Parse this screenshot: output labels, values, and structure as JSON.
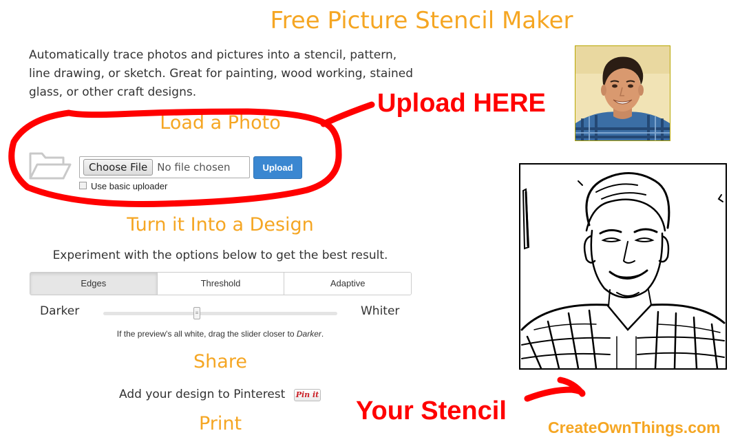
{
  "header": {
    "title": "Free Picture Stencil Maker"
  },
  "intro": {
    "text": "Automatically trace photos and pictures into a stencil, pattern, line drawing, or sketch. Great for painting, wood working, stained glass, or other craft designs."
  },
  "load": {
    "heading": "Load a Photo",
    "choose_file_label": "Choose File",
    "file_status": "No file chosen",
    "upload_label": "Upload",
    "basic_uploader_label": "Use basic uploader",
    "basic_uploader_checked": false
  },
  "design": {
    "heading": "Turn it Into a Design",
    "instructions": "Experiment with the options below to get the best result.",
    "tabs": [
      {
        "label": "Edges",
        "active": true
      },
      {
        "label": "Threshold",
        "active": false
      },
      {
        "label": "Adaptive",
        "active": false
      }
    ],
    "slider": {
      "min_label": "Darker",
      "max_label": "Whiter",
      "value_fraction": 0.4,
      "hint_prefix": "If the preview's all white, drag the slider closer to ",
      "hint_emph": "Darker",
      "hint_suffix": "."
    }
  },
  "share": {
    "heading": "Share",
    "pinterest_text": "Add your design to Pinterest",
    "pinit_label": "Pin it"
  },
  "print": {
    "heading": "Print"
  },
  "annotations": {
    "upload_here": "Upload HERE",
    "your_stencil": "Your Stencil",
    "site": "CreateOwnThings.com"
  },
  "colors": {
    "accent": "#f5a623",
    "annotation": "#ff0000",
    "upload_button": "#3a87d1"
  },
  "icons": {
    "folder": "folder-open-icon",
    "pinterest": "pinterest-pinit-icon"
  }
}
